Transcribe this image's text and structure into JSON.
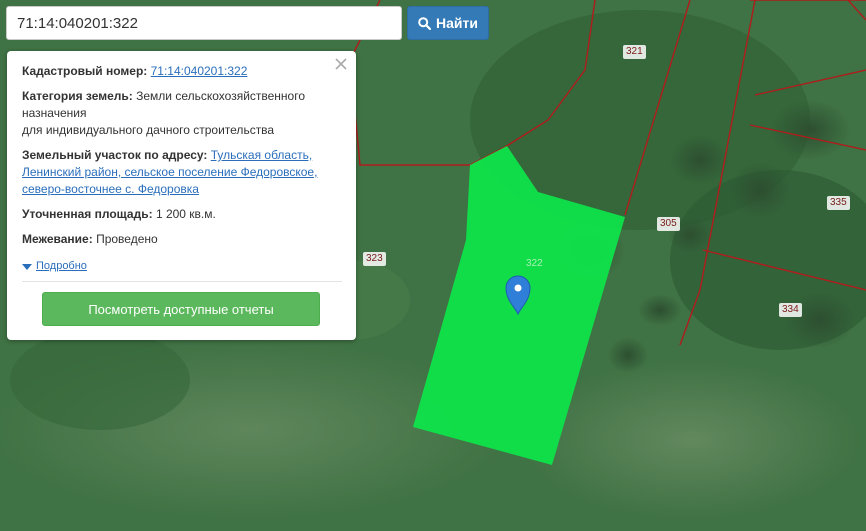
{
  "search": {
    "value": "71:14:040201:322",
    "button_label": "Найти"
  },
  "info": {
    "cadastral_label": "Кадастровый номер:",
    "cadastral_value": "71:14:040201:322",
    "category_label": "Категория земель:",
    "category_line1": "Земли сельскохозяйственного",
    "category_line2": "назначения",
    "category_line3": "для индивидуального дачного строительства",
    "address_label": "Земельный участок по адресу:",
    "address_line1": "Тульская область,",
    "address_line2": "Ленинский район, сельское поселение Федоровское,",
    "address_line3": "северо-восточнее с. Федоровка",
    "area_label": "Уточненная площадь:",
    "area_value": "1 200 кв.м.",
    "survey_label": "Межевание:",
    "survey_value": "Проведено",
    "details_link": "Подробно",
    "reports_button": "Посмотреть доступные отчеты"
  },
  "map": {
    "plot_labels": [
      "321",
      "322",
      "323",
      "305",
      "335",
      "334"
    ],
    "selected_plot": "322",
    "selected_fill": "#0fe34a",
    "boundary_color": "#b01c1c",
    "marker_color": "#2f7ed8"
  }
}
